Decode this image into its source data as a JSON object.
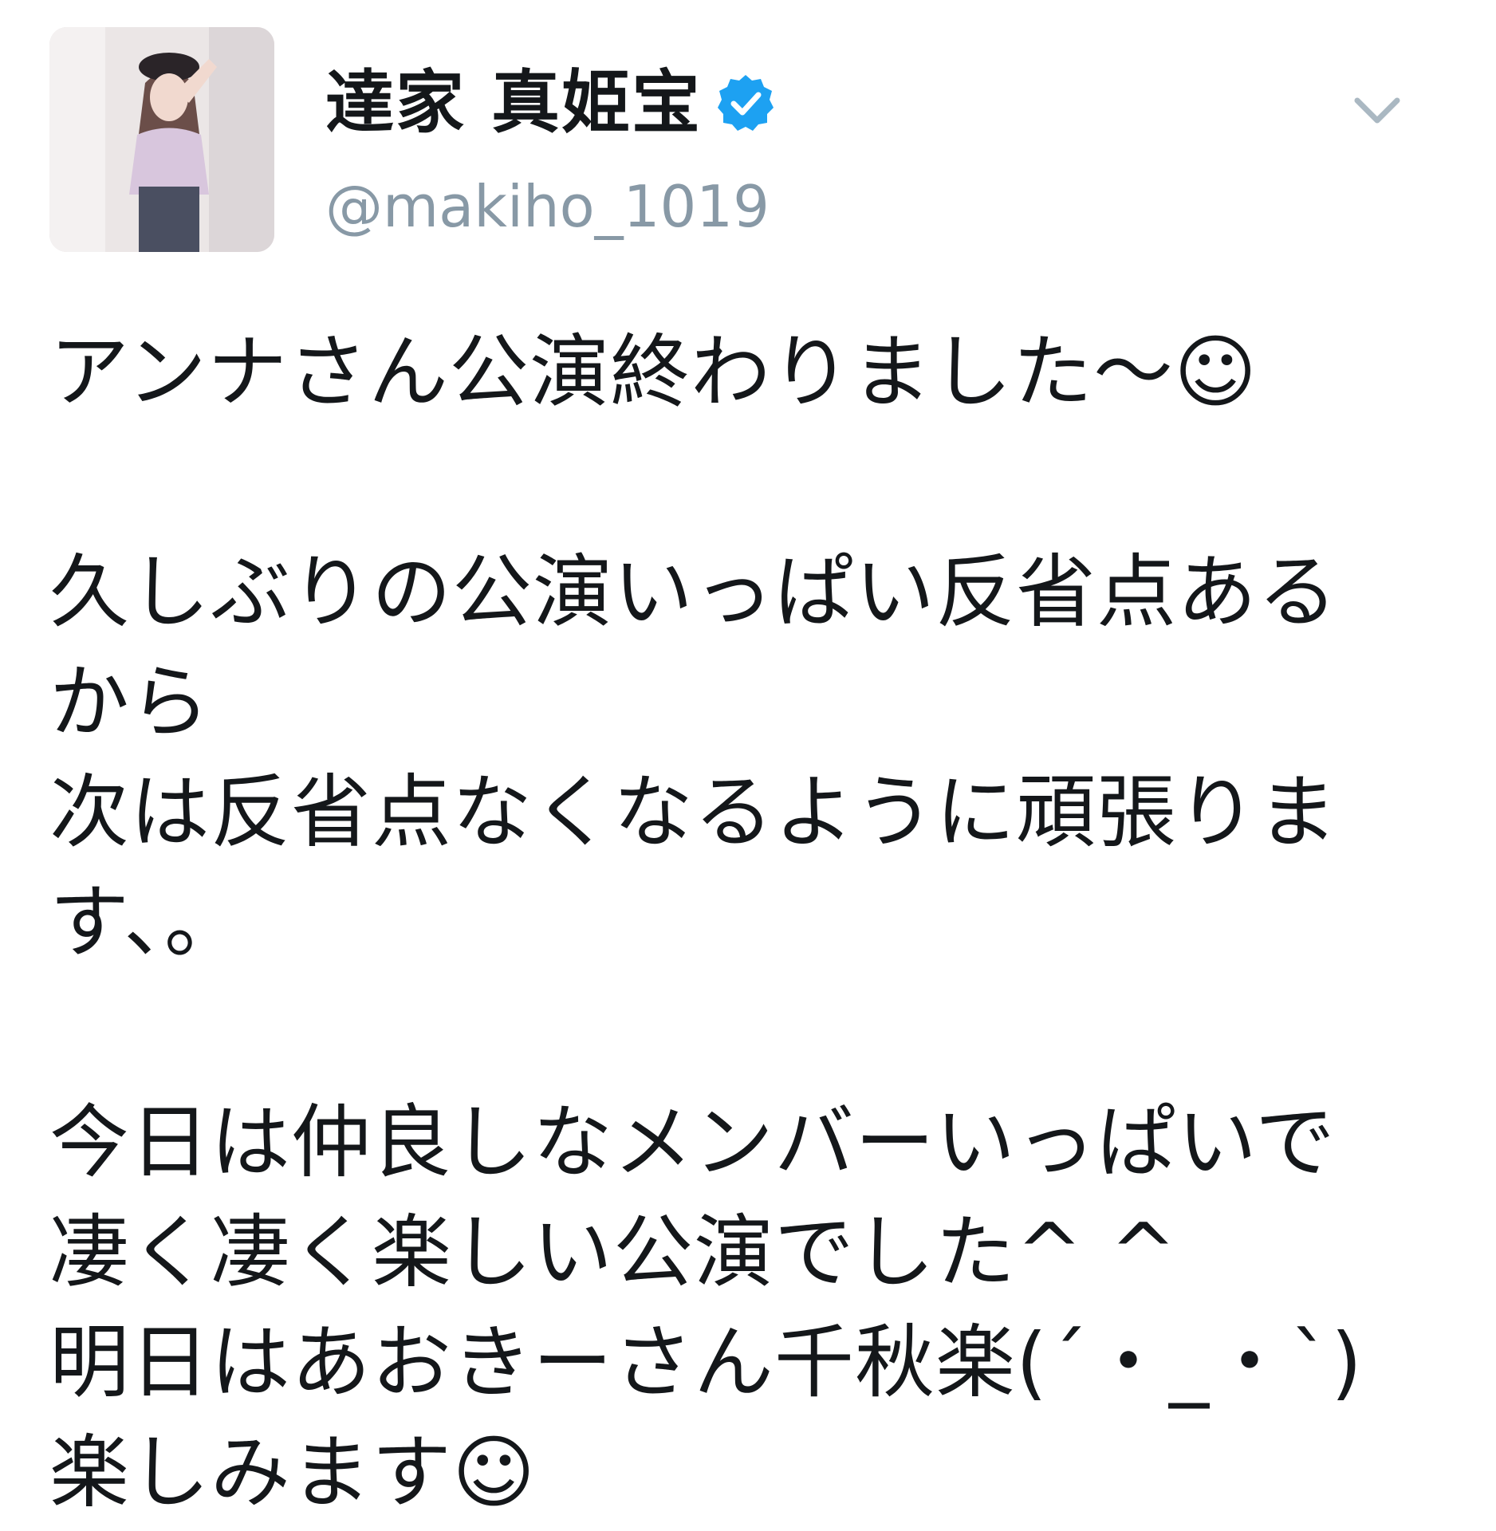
{
  "user": {
    "display_name": "達家 真姫宝",
    "handle": "@makiho_1019",
    "verified": true,
    "avatar_icon": "profile-photo",
    "verified_icon": "verified-badge-icon",
    "menu_icon": "chevron-down-icon"
  },
  "tweet": {
    "lines": [
      "アンナさん公演終わりました〜☺",
      "",
      "久しぶりの公演いっぱい反省点ある",
      "から",
      "次は反省点なくなるように頑張りま",
      "す、。",
      "",
      "今日は仲良しなメンバーいっぱいで",
      "凄く凄く楽しい公演でした^ ^",
      "明日はあおきーさん千秋楽(´・_・`)",
      "楽しみます☺"
    ]
  },
  "colors": {
    "text": "#14171a",
    "handle": "#8899a6",
    "verified": "#1da1f2",
    "caret": "#aab8c2",
    "background": "#ffffff"
  }
}
